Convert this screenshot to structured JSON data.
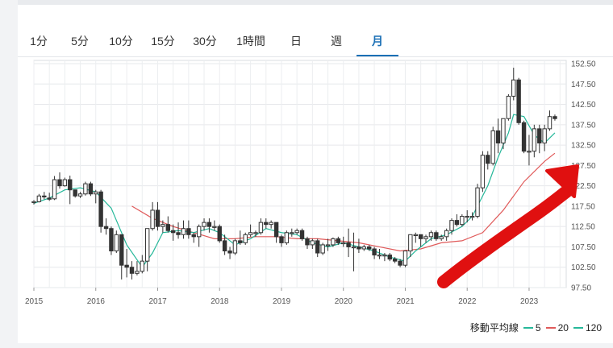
{
  "timeframe_tabs": [
    {
      "label": "1分",
      "active": false
    },
    {
      "label": "5分",
      "active": false
    },
    {
      "label": "10分",
      "active": false
    },
    {
      "label": "15分",
      "active": false
    },
    {
      "label": "30分",
      "active": false
    },
    {
      "label": "1時間",
      "active": false
    },
    {
      "label": "日",
      "active": false
    },
    {
      "label": "週",
      "active": false
    },
    {
      "label": "月",
      "active": true
    }
  ],
  "colors": {
    "accent": "#1a6fb5",
    "ma5": "#26b89a",
    "ma20": "#e05a5a",
    "ma120": "#26b89a",
    "candle": "#333333",
    "arrow": "#e01010"
  },
  "legend": {
    "title": "移動平均線",
    "items": [
      {
        "label": "5",
        "color": "#26b89a"
      },
      {
        "label": "20",
        "color": "#e05a5a"
      },
      {
        "label": "120",
        "color": "#26b89a"
      }
    ]
  },
  "annotation": {
    "type": "red-arrow",
    "direction": "up-right"
  },
  "chart_data": {
    "type": "candlestick",
    "y_ticks": [
      "152.50",
      "147.50",
      "142.50",
      "137.50",
      "132.50",
      "127.50",
      "122.50",
      "117.50",
      "112.50",
      "107.50",
      "102.50",
      "97.50"
    ],
    "x_ticks": [
      "2015",
      "2016",
      "2017",
      "2018",
      "2019",
      "2020",
      "2021",
      "2022",
      "2023"
    ],
    "ylim": [
      97.5,
      152.5
    ],
    "xlim": [
      2015.0,
      2023.6
    ],
    "grid": true,
    "candles": [
      [
        2015.0,
        118.4,
        118.6,
        117.9,
        119.0
      ],
      [
        2015.083,
        118.6,
        120.0,
        118.4,
        120.5
      ],
      [
        2015.167,
        120.0,
        119.9,
        119.2,
        121.0
      ],
      [
        2015.25,
        119.5,
        119.2,
        118.8,
        120.8
      ],
      [
        2015.333,
        119.3,
        124.0,
        119.0,
        124.9
      ],
      [
        2015.417,
        124.0,
        122.5,
        121.8,
        125.8
      ],
      [
        2015.5,
        122.5,
        124.0,
        122.3,
        124.5
      ],
      [
        2015.583,
        124.0,
        121.5,
        118.0,
        125.0
      ],
      [
        2015.667,
        121.5,
        120.0,
        119.6,
        121.0
      ],
      [
        2015.75,
        120.0,
        120.5,
        119.5,
        121.0
      ],
      [
        2015.833,
        120.5,
        123.0,
        120.1,
        123.5
      ],
      [
        2015.917,
        123.0,
        120.5,
        120.0,
        123.5
      ],
      [
        2016.0,
        120.5,
        121.0,
        118.2,
        121.5
      ],
      [
        2016.083,
        121.0,
        112.5,
        111.0,
        121.5
      ],
      [
        2016.167,
        112.5,
        112.0,
        110.5,
        114.5
      ],
      [
        2016.25,
        112.0,
        106.5,
        105.5,
        112.5
      ],
      [
        2016.333,
        106.5,
        110.5,
        106.0,
        111.5
      ],
      [
        2016.417,
        110.5,
        103.0,
        99.5,
        110.5
      ],
      [
        2016.5,
        103.0,
        102.5,
        100.0,
        107.0
      ],
      [
        2016.583,
        102.5,
        101.0,
        99.5,
        104.0
      ],
      [
        2016.667,
        101.0,
        101.5,
        100.5,
        104.0
      ],
      [
        2016.75,
        101.5,
        104.0,
        101.0,
        105.5
      ],
      [
        2016.833,
        104.0,
        112.0,
        101.5,
        112.0
      ],
      [
        2016.917,
        112.0,
        116.5,
        111.5,
        118.5
      ],
      [
        2017.0,
        116.5,
        112.5,
        111.5,
        118.5
      ],
      [
        2017.083,
        112.5,
        113.0,
        111.0,
        114.0
      ],
      [
        2017.167,
        113.0,
        111.5,
        111.0,
        115.0
      ],
      [
        2017.25,
        111.5,
        111.0,
        109.0,
        113.0
      ],
      [
        2017.333,
        111.0,
        110.5,
        109.5,
        113.5
      ],
      [
        2017.417,
        110.5,
        112.0,
        109.5,
        114.0
      ],
      [
        2017.5,
        112.0,
        110.5,
        109.5,
        114.0
      ],
      [
        2017.583,
        110.5,
        110.0,
        108.5,
        111.0
      ],
      [
        2017.667,
        110.0,
        112.5,
        107.5,
        113.0
      ],
      [
        2017.75,
        112.5,
        113.5,
        111.5,
        114.5
      ],
      [
        2017.833,
        113.5,
        112.5,
        111.0,
        114.5
      ],
      [
        2017.917,
        112.5,
        112.5,
        111.5,
        114.0
      ],
      [
        2018.0,
        112.5,
        109.0,
        108.5,
        113.0
      ],
      [
        2018.083,
        109.0,
        106.5,
        105.5,
        110.5
      ],
      [
        2018.167,
        106.5,
        106.0,
        104.5,
        107.5
      ],
      [
        2018.25,
        106.0,
        109.0,
        105.5,
        109.5
      ],
      [
        2018.333,
        109.0,
        108.5,
        108.0,
        111.5
      ],
      [
        2018.417,
        108.5,
        110.5,
        108.0,
        111.0
      ],
      [
        2018.5,
        110.5,
        111.0,
        110.0,
        113.0
      ],
      [
        2018.583,
        111.0,
        111.0,
        110.0,
        111.5
      ],
      [
        2018.667,
        111.0,
        113.5,
        110.5,
        114.5
      ],
      [
        2018.75,
        113.5,
        113.0,
        112.0,
        114.5
      ],
      [
        2018.833,
        113.0,
        113.5,
        112.0,
        114.0
      ],
      [
        2018.917,
        113.5,
        110.0,
        108.5,
        113.5
      ],
      [
        2019.0,
        110.0,
        108.5,
        107.5,
        110.5
      ],
      [
        2019.083,
        108.5,
        111.0,
        108.0,
        111.5
      ],
      [
        2019.167,
        111.0,
        111.0,
        110.0,
        112.0
      ],
      [
        2019.25,
        111.0,
        111.5,
        110.5,
        112.0
      ],
      [
        2019.333,
        111.5,
        109.5,
        109.0,
        112.0
      ],
      [
        2019.417,
        109.5,
        108.0,
        107.0,
        110.0
      ],
      [
        2019.5,
        108.0,
        109.0,
        107.0,
        109.5
      ],
      [
        2019.583,
        109.0,
        106.0,
        105.0,
        109.5
      ],
      [
        2019.667,
        106.0,
        108.0,
        105.5,
        108.5
      ],
      [
        2019.75,
        108.0,
        108.0,
        106.5,
        109.5
      ],
      [
        2019.833,
        108.0,
        109.5,
        107.5,
        109.8
      ],
      [
        2019.917,
        109.5,
        108.5,
        108.0,
        110.0
      ],
      [
        2020.0,
        108.5,
        108.5,
        107.5,
        110.0
      ],
      [
        2020.083,
        108.5,
        107.5,
        105.0,
        112.0
      ],
      [
        2020.167,
        107.5,
        107.5,
        101.5,
        111.0
      ],
      [
        2020.25,
        107.5,
        107.0,
        106.0,
        109.5
      ],
      [
        2020.333,
        107.0,
        107.5,
        106.5,
        108.0
      ],
      [
        2020.417,
        107.5,
        107.0,
        106.5,
        108.0
      ],
      [
        2020.5,
        107.0,
        105.5,
        104.5,
        107.5
      ],
      [
        2020.583,
        105.5,
        105.5,
        104.5,
        107.0
      ],
      [
        2020.667,
        105.5,
        105.5,
        104.0,
        106.0
      ],
      [
        2020.75,
        105.5,
        104.5,
        104.0,
        106.0
      ],
      [
        2020.833,
        104.5,
        104.0,
        103.5,
        105.0
      ],
      [
        2020.917,
        104.0,
        103.0,
        102.5,
        104.5
      ],
      [
        2021.0,
        103.0,
        106.5,
        102.5,
        106.5
      ],
      [
        2021.083,
        106.5,
        110.5,
        105.0,
        110.5
      ],
      [
        2021.167,
        110.5,
        110.5,
        108.5,
        111.0
      ],
      [
        2021.25,
        110.5,
        109.5,
        107.5,
        110.5
      ],
      [
        2021.333,
        109.5,
        110.0,
        108.5,
        110.5
      ],
      [
        2021.417,
        110.0,
        111.0,
        109.0,
        111.5
      ],
      [
        2021.5,
        111.0,
        109.5,
        109.0,
        111.5
      ],
      [
        2021.583,
        109.5,
        110.0,
        109.0,
        110.5
      ],
      [
        2021.667,
        110.0,
        111.5,
        109.0,
        112.0
      ],
      [
        2021.75,
        111.5,
        114.0,
        110.5,
        114.5
      ],
      [
        2021.833,
        114.0,
        113.0,
        112.5,
        115.5
      ],
      [
        2021.917,
        113.0,
        115.0,
        112.5,
        115.5
      ],
      [
        2022.0,
        115.0,
        115.0,
        113.5,
        116.5
      ],
      [
        2022.083,
        115.0,
        115.0,
        114.0,
        116.0
      ],
      [
        2022.167,
        115.0,
        122.0,
        114.5,
        123.0
      ],
      [
        2022.25,
        122.0,
        130.0,
        121.0,
        131.0
      ],
      [
        2022.333,
        130.0,
        128.0,
        126.5,
        131.0
      ],
      [
        2022.417,
        128.0,
        136.0,
        127.5,
        137.0
      ],
      [
        2022.5,
        136.0,
        133.0,
        130.5,
        139.0
      ],
      [
        2022.583,
        133.0,
        139.0,
        131.5,
        139.0
      ],
      [
        2022.667,
        139.0,
        144.5,
        138.5,
        145.0
      ],
      [
        2022.75,
        144.5,
        148.5,
        143.5,
        151.5
      ],
      [
        2022.833,
        148.5,
        138.0,
        137.5,
        149.0
      ],
      [
        2022.917,
        138.0,
        131.0,
        130.5,
        138.5
      ],
      [
        2023.0,
        131.0,
        131.0,
        127.5,
        135.0
      ],
      [
        2023.083,
        131.0,
        136.5,
        129.5,
        137.5
      ],
      [
        2023.167,
        136.5,
        133.0,
        130.5,
        137.5
      ],
      [
        2023.25,
        133.0,
        136.5,
        131.0,
        137.5
      ],
      [
        2023.333,
        136.5,
        139.5,
        136.0,
        141.0
      ],
      [
        2023.417,
        139.5,
        139.0,
        138.5,
        140.0
      ]
    ],
    "ma5": [
      [
        2015.0,
        118.2
      ],
      [
        2015.25,
        119.5
      ],
      [
        2015.5,
        121.5
      ],
      [
        2015.75,
        122.0
      ],
      [
        2016.0,
        121.0
      ],
      [
        2016.25,
        117.0
      ],
      [
        2016.5,
        108.0
      ],
      [
        2016.75,
        102.5
      ],
      [
        2016.917,
        106.0
      ],
      [
        2017.083,
        111.0
      ],
      [
        2017.333,
        111.5
      ],
      [
        2017.583,
        111.0
      ],
      [
        2017.833,
        112.0
      ],
      [
        2018.0,
        111.0
      ],
      [
        2018.25,
        108.0
      ],
      [
        2018.5,
        109.5
      ],
      [
        2018.75,
        112.0
      ],
      [
        2019.0,
        111.0
      ],
      [
        2019.25,
        110.5
      ],
      [
        2019.5,
        108.5
      ],
      [
        2019.75,
        107.5
      ],
      [
        2020.0,
        108.5
      ],
      [
        2020.25,
        107.5
      ],
      [
        2020.5,
        106.5
      ],
      [
        2020.75,
        105.0
      ],
      [
        2021.0,
        104.0
      ],
      [
        2021.167,
        106.5
      ],
      [
        2021.417,
        109.5
      ],
      [
        2021.667,
        110.5
      ],
      [
        2021.917,
        112.5
      ],
      [
        2022.083,
        115.0
      ],
      [
        2022.333,
        122.5
      ],
      [
        2022.5,
        129.5
      ],
      [
        2022.667,
        135.5
      ],
      [
        2022.75,
        140.0
      ],
      [
        2022.917,
        139.5
      ],
      [
        2023.083,
        135.0
      ],
      [
        2023.25,
        133.0
      ],
      [
        2023.417,
        135.5
      ]
    ],
    "ma20": [
      [
        2016.583,
        117.5
      ],
      [
        2016.917,
        114.5
      ],
      [
        2017.25,
        112.5
      ],
      [
        2017.583,
        111.0
      ],
      [
        2017.917,
        109.5
      ],
      [
        2018.25,
        109.5
      ],
      [
        2018.583,
        110.0
      ],
      [
        2018.917,
        110.0
      ],
      [
        2019.25,
        109.5
      ],
      [
        2019.583,
        109.5
      ],
      [
        2019.917,
        109.0
      ],
      [
        2020.25,
        108.5
      ],
      [
        2020.583,
        107.5
      ],
      [
        2020.917,
        106.5
      ],
      [
        2021.25,
        107.0
      ],
      [
        2021.583,
        108.5
      ],
      [
        2021.917,
        109.0
      ],
      [
        2022.25,
        111.0
      ],
      [
        2022.583,
        116.5
      ],
      [
        2022.917,
        123.5
      ],
      [
        2023.25,
        128.5
      ],
      [
        2023.417,
        130.5
      ]
    ]
  }
}
